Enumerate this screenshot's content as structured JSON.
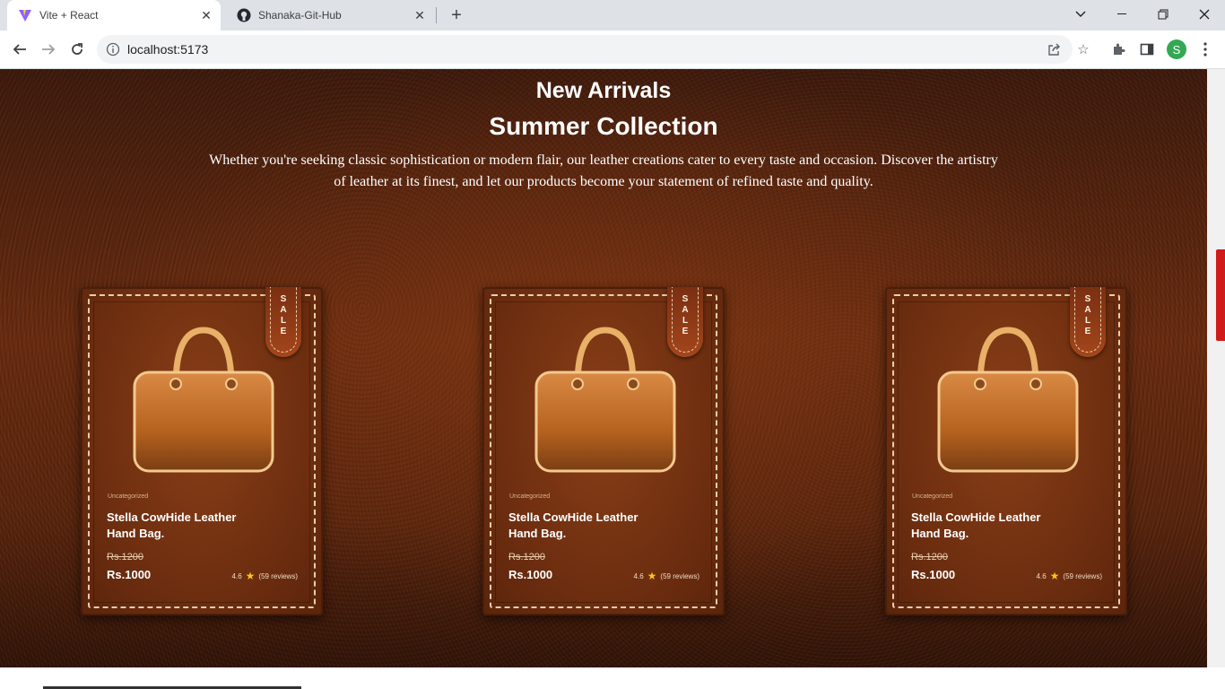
{
  "browser": {
    "tabs": [
      {
        "title": "Vite + React",
        "active": true,
        "icon": "vite-icon"
      },
      {
        "title": "Shanaka-Git-Hub",
        "active": false,
        "icon": "github-icon"
      }
    ],
    "url": "localhost:5173",
    "profile_initial": "S"
  },
  "page": {
    "heading": "New Arrivals",
    "subheading": "Summer Collection",
    "description": "Whether you're seeking classic sophistication or modern flair, our leather creations cater to every taste and occasion. Discover the artistry of leather at its finest, and let our products become your statement of refined taste and quality.",
    "products": [
      {
        "tag": "SALE",
        "category": "Uncategorized",
        "name": "Stella CowHide Leather Hand Bag.",
        "old_price": "Rs.1200",
        "price": "Rs.1000",
        "rating": "4.6",
        "reviews": "(59 reviews)"
      },
      {
        "tag": "SALE",
        "category": "Uncategorized",
        "name": "Stella CowHide Leather Hand Bag.",
        "old_price": "Rs.1200",
        "price": "Rs.1000",
        "rating": "4.6",
        "reviews": "(59 reviews)"
      },
      {
        "tag": "SALE",
        "category": "Uncategorized",
        "name": "Stella CowHide Leather Hand Bag.",
        "old_price": "Rs.1200",
        "price": "Rs.1000",
        "rating": "4.6",
        "reviews": "(59 reviews)"
      }
    ]
  },
  "colors": {
    "leather_bg": "#5a250d",
    "card_bg": "#7a3512",
    "stitch": "#e8cfae",
    "star": "#ffc21a",
    "scroll_thumb": "#d11a1a"
  }
}
